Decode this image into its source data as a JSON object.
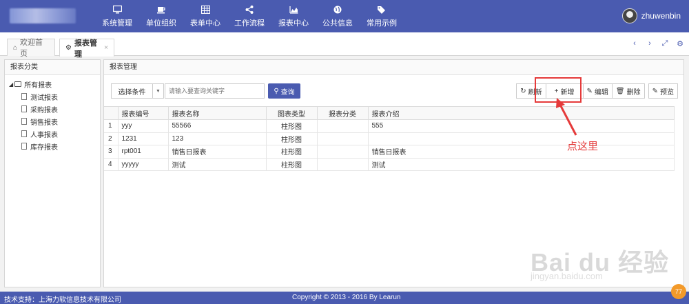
{
  "header": {
    "nav": [
      {
        "label": "系统管理",
        "icon": "monitor-icon"
      },
      {
        "label": "单位组织",
        "icon": "coffee-icon"
      },
      {
        "label": "表单中心",
        "icon": "table-icon"
      },
      {
        "label": "工作流程",
        "icon": "share-icon"
      },
      {
        "label": "报表中心",
        "icon": "area-chart-icon"
      },
      {
        "label": "公共信息",
        "icon": "globe-icon"
      },
      {
        "label": "常用示例",
        "icon": "tags-icon"
      }
    ],
    "username": "zhuwenbin",
    "brand_color": "#4a5bb0"
  },
  "tabs": [
    {
      "label": "欢迎首页",
      "icon": "home-icon"
    },
    {
      "label": "报表管理",
      "icon": "cogs-icon",
      "close": "×"
    }
  ],
  "tab_tools": [
    "‹",
    "›",
    "⤢",
    "⚙"
  ],
  "sidebar": {
    "title": "报表分类",
    "root": "所有报表",
    "items": [
      "测试报表",
      "采购报表",
      "销售报表",
      "人事报表",
      "库存报表"
    ]
  },
  "main": {
    "title": "报表管理",
    "filter": {
      "select_label": "选择条件",
      "search_placeholder": "请输入要查询关键字",
      "search_button": "查询"
    },
    "actions": {
      "refresh": "刷新",
      "add": "新增",
      "edit": "编辑",
      "delete": "删除",
      "preview": "预览"
    },
    "table": {
      "columns": [
        "报表编号",
        "报表名称",
        "图表类型",
        "报表分类",
        "报表介绍"
      ],
      "rows": [
        {
          "n": "1",
          "code": "yyy",
          "name": "55566",
          "type": "柱形图",
          "category": "",
          "intro": "555"
        },
        {
          "n": "2",
          "code": "1231",
          "name": "123",
          "type": "柱形图",
          "category": "",
          "intro": ""
        },
        {
          "n": "3",
          "code": "rpt001",
          "name": "销售日报表",
          "type": "柱形图",
          "category": "",
          "intro": "销售日报表"
        },
        {
          "n": "4",
          "code": "yyyyy",
          "name": "测试",
          "type": "柱形图",
          "category": "",
          "intro": "测试"
        }
      ]
    }
  },
  "annotation": {
    "text": "点这里",
    "color": "#e53a3a"
  },
  "watermark": {
    "main": "Bai du 经验",
    "sub": "jingyan.baidu.com"
  },
  "footer": {
    "left": "技术支持：上海力软信息技术有限公司",
    "center": "Copyright © 2013 - 2016 By Learun",
    "badge": "77"
  }
}
